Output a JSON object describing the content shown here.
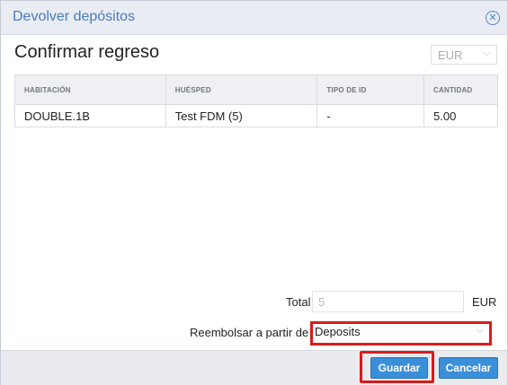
{
  "dialog": {
    "title": "Devolver depósitos",
    "close_icon": "close-circle-icon"
  },
  "heading": "Confirmar regreso",
  "currency_select": {
    "value": "EUR"
  },
  "table": {
    "headers": [
      "HABITACIÓN",
      "HUÉSPED",
      "TIPO DE ID",
      "CANTIDAD"
    ],
    "rows": [
      [
        "DOUBLE.1B",
        "Test FDM (5)",
        "-",
        "5.00"
      ]
    ]
  },
  "total": {
    "label": "Total",
    "value": "5",
    "currency": "EUR"
  },
  "refund": {
    "label": "Reembolsar a partir de",
    "value": "Deposits"
  },
  "buttons": {
    "save": "Guardar",
    "cancel": "Cancelar"
  },
  "colors": {
    "primary": "#3b8fd9",
    "highlight": "#d91c1c",
    "title": "#4a7bbf"
  }
}
